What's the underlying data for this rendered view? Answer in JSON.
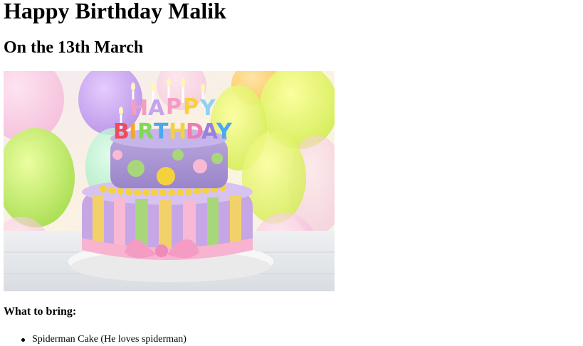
{
  "page": {
    "title": "Happy Birthday Malik",
    "date_line": "On the 13th March"
  },
  "image": {
    "description_icon": "birthday-cake-photo",
    "cake_topper_text": "HAPPY BIRTHDAY"
  },
  "bring_section": {
    "heading": "What to bring:",
    "items": [
      {
        "label": "Spiderman Cake (He loves spiderman)"
      }
    ]
  }
}
